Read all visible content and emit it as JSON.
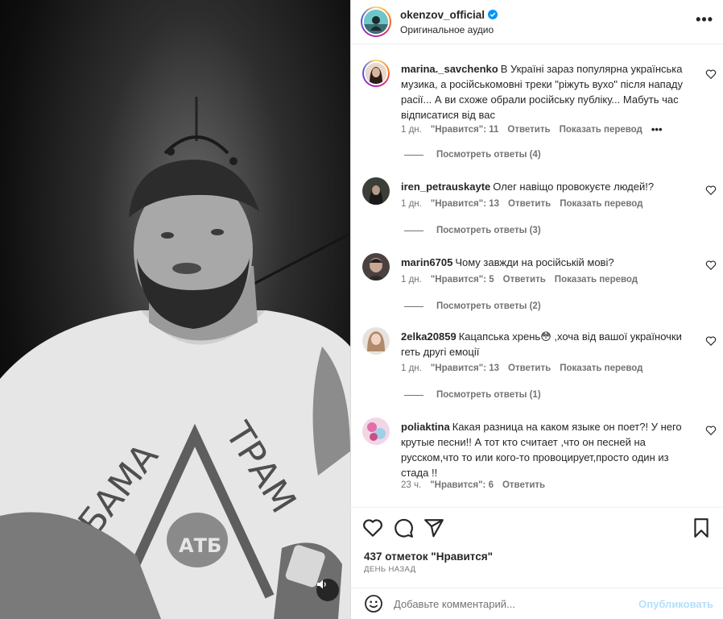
{
  "post": {
    "username": "okenzov_official",
    "audio_label": "Оригинальное аудио",
    "more_label": "•••"
  },
  "comments": [
    {
      "username": "marina._savchenko",
      "text": "В Україні зараз популярна українська музика, а російськомовні треки \"ріжуть вухо\" після нападу расії... А ви схоже обрали російську публіку... Мабуть час відписатися від вас",
      "time": "1 дн.",
      "likes": "\"Нравится\": 11",
      "reply": "Ответить",
      "translate": "Показать перевод",
      "options": "•••",
      "replies": "Посмотреть ответы (4)"
    },
    {
      "username": "iren_petrauskayte",
      "text": "Олег навіщо провокуєте людей!?",
      "time": "1 дн.",
      "likes": "\"Нравится\": 13",
      "reply": "Ответить",
      "translate": "Показать перевод",
      "replies": "Посмотреть ответы (3)"
    },
    {
      "username": "marin6705",
      "text": "Чому завжди на російській мові?",
      "time": "1 дн.",
      "likes": "\"Нравится\": 5",
      "reply": "Ответить",
      "translate": "Показать перевод",
      "replies": "Посмотреть ответы (2)"
    },
    {
      "username": "2elka20859",
      "text": "Кацапська хрень😳 ,хоча від вашої україночки геть другі емоції",
      "time": "1 дн.",
      "likes": "\"Нравится\": 13",
      "reply": "Ответить",
      "translate": "Показать перевод",
      "replies": "Посмотреть ответы (1)"
    },
    {
      "username": "poliaktina",
      "text": "Какая разница на каком языке он поет?! У него крутые песни!! А тот кто считает ,что он песней на русском,что то или кого-то провоцирует,просто один из стада !!",
      "time": "23 ч.",
      "likes": "\"Нравится\": 6",
      "reply": "Ответить"
    }
  ],
  "likes_summary": "437 отметок \"Нравится\"",
  "date_label": "ДЕНЬ НАЗАД",
  "add_comment": {
    "placeholder": "Добавьте комментарий...",
    "publish_label": "Опубликовать"
  },
  "colors": {
    "verified": "#0095f6",
    "publish_disabled": "#b2dffc",
    "meta_gray": "#737373"
  },
  "video_shirt_text": [
    "БАМА",
    "ТРАМ",
    "АТБ"
  ]
}
